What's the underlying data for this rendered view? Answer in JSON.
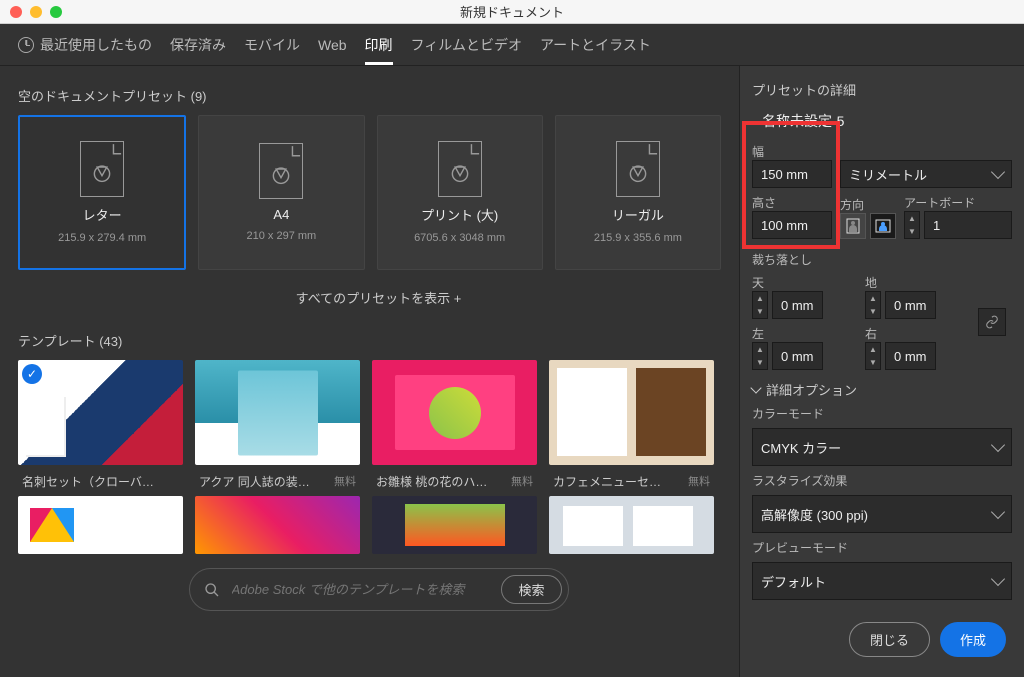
{
  "window": {
    "title": "新規ドキュメント"
  },
  "tabs": {
    "recent": "最近使用したもの",
    "saved": "保存済み",
    "mobile": "モバイル",
    "web": "Web",
    "print": "印刷",
    "film": "フィルムとビデオ",
    "art": "アートとイラスト"
  },
  "sections": {
    "blank_presets": "空のドキュメントプリセット  (9)",
    "view_all": "すべてのプリセットを表示 +",
    "templates": "テンプレート  (43)"
  },
  "presets": {
    "letter": {
      "name": "レター",
      "dims": "215.9 x 279.4 mm"
    },
    "a4": {
      "name": "A4",
      "dims": "210 x 297 mm"
    },
    "large": {
      "name": "プリント (大)",
      "dims": "6705.6 x 3048 mm"
    },
    "legal": {
      "name": "リーガル",
      "dims": "215.9 x 355.6 mm"
    }
  },
  "templates_row": {
    "t1": {
      "name": "名刺セット（クローバ…",
      "free": ""
    },
    "t2": {
      "name": "アクア 同人誌の装…",
      "free": "無料"
    },
    "t3": {
      "name": "お雛様 桃の花のハ…",
      "free": "無料"
    },
    "t4": {
      "name": "カフェメニューセ…",
      "free": "無料"
    }
  },
  "search": {
    "placeholder": "Adobe Stock で他のテンプレートを検索",
    "button": "検索"
  },
  "details": {
    "heading": "プリセットの詳細",
    "doc_name": "名称未設定-5",
    "width_label": "幅",
    "width_value": "150 mm",
    "height_label": "高さ",
    "height_value": "100 mm",
    "unit": "ミリメートル",
    "orient_label": "方向",
    "artboard_label": "アートボード",
    "artboard_count": "1",
    "bleed_label": "裁ち落とし",
    "bleed_top_label": "天",
    "bleed_bottom_label": "地",
    "bleed_left_label": "左",
    "bleed_right_label": "右",
    "bleed_top": "0 mm",
    "bleed_bottom": "0 mm",
    "bleed_left": "0 mm",
    "bleed_right": "0 mm",
    "advanced": "詳細オプション",
    "color_mode_label": "カラーモード",
    "color_mode": "CMYK カラー",
    "raster_label": "ラスタライズ効果",
    "raster": "高解像度 (300 ppi)",
    "preview_label": "プレビューモード",
    "preview": "デフォルト"
  },
  "buttons": {
    "close": "閉じる",
    "create": "作成"
  }
}
